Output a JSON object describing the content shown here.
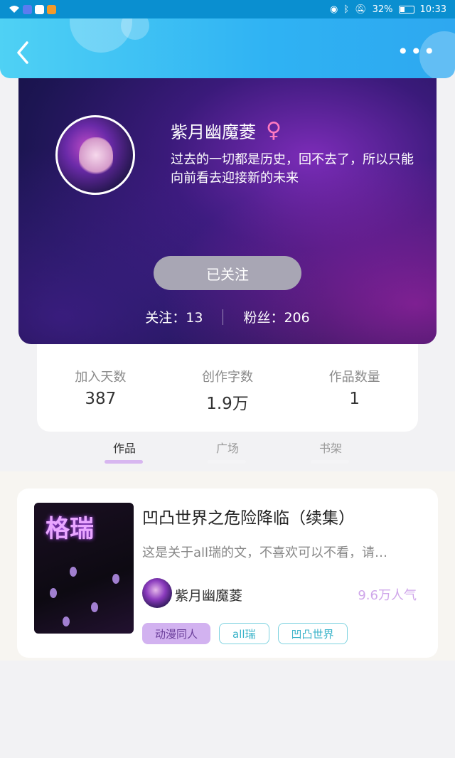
{
  "status_bar": {
    "battery": "32%",
    "time": "10:33"
  },
  "header": {
    "back_icon": "chevron-left-icon",
    "more_label": "•••"
  },
  "profile": {
    "name": "紫月幽魔菱",
    "gender_symbol": "♀",
    "bio": "过去的一切都是历史，回不去了，所以只能向前看去迎接新的未来",
    "follow_button": "已关注",
    "following_label": "关注：",
    "following_count": "13",
    "fans_label": "粉丝：",
    "fans_count": "206"
  },
  "stats": [
    {
      "label": "加入天数",
      "value": "387"
    },
    {
      "label": "创作字数",
      "value": "1.9万"
    },
    {
      "label": "作品数量",
      "value": "1"
    }
  ],
  "tabs": [
    {
      "label": "作品",
      "active": true
    },
    {
      "label": "广场",
      "active": false
    },
    {
      "label": "书架",
      "active": false
    }
  ],
  "work": {
    "cover_text": "格瑞",
    "title": "凹凸世界之危险降临（续集）",
    "description": "这是关于all瑞的文，不喜欢可以不看，请…",
    "author": "紫月幽魔菱",
    "popularity": "9.6万人气",
    "tags": [
      "动漫同人",
      "all瑞",
      "凹凸世界"
    ]
  },
  "colors": {
    "header_accent": "#2fb2f3",
    "tag_fill": "#d2b2f0",
    "tag_outline": "#7fd3e0",
    "popularity": "#cfa6ea",
    "active_tab_underline": "#d7b6f0"
  }
}
